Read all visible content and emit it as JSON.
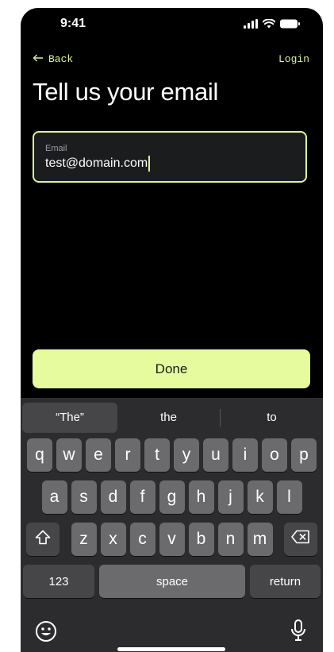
{
  "status_bar": {
    "time": "9:41"
  },
  "nav": {
    "back_label": "Back",
    "login_label": "Login"
  },
  "title": "Tell us your email",
  "email": {
    "label": "Email",
    "value": "test@domain.com"
  },
  "done_label": "Done",
  "keyboard": {
    "suggestions": [
      "“The”",
      "the",
      "to"
    ],
    "row1": [
      "q",
      "w",
      "e",
      "r",
      "t",
      "y",
      "u",
      "i",
      "o",
      "p"
    ],
    "row2": [
      "a",
      "s",
      "d",
      "f",
      "g",
      "h",
      "j",
      "k",
      "l"
    ],
    "row3": [
      "z",
      "x",
      "c",
      "v",
      "b",
      "n",
      "m"
    ],
    "numbers_label": "123",
    "space_label": "space",
    "return_label": "return"
  },
  "colors": {
    "accent": "#d9f59a",
    "button_bg": "#e6fb9e",
    "background": "#000000",
    "keyboard_bg": "#2c2c2e",
    "key_bg": "#6b6b6e"
  },
  "icons": {
    "back": "arrow-left-icon",
    "signal": "signal-icon",
    "wifi": "wifi-icon",
    "battery": "battery-icon",
    "shift": "shift-icon",
    "delete": "backspace-icon",
    "emoji": "emoji-icon",
    "mic": "microphone-icon"
  }
}
